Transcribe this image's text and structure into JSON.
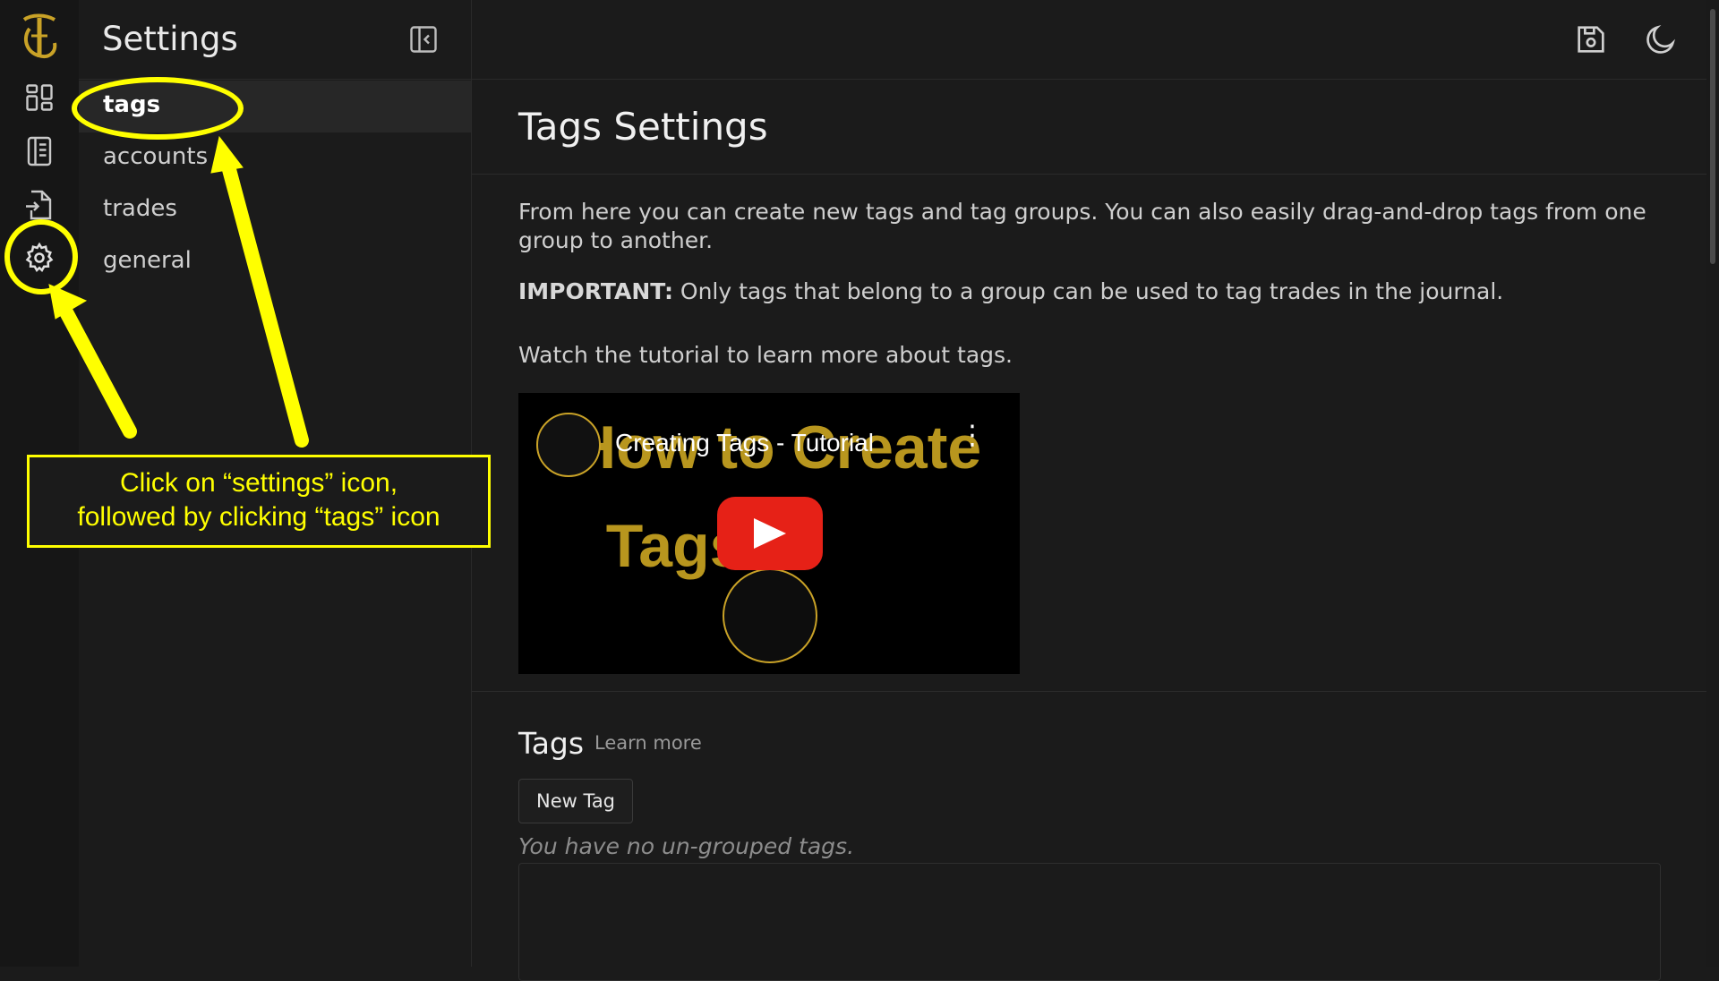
{
  "rail": {
    "items": [
      {
        "name": "logo"
      },
      {
        "name": "dashboard-icon"
      },
      {
        "name": "journal-icon"
      },
      {
        "name": "import-icon"
      },
      {
        "name": "settings-icon"
      }
    ]
  },
  "sidebar": {
    "title": "Settings",
    "items": [
      {
        "label": "tags",
        "active": true
      },
      {
        "label": "accounts"
      },
      {
        "label": "trades"
      },
      {
        "label": "general"
      }
    ]
  },
  "topbar": {
    "icons": [
      "save-icon",
      "moon-icon"
    ]
  },
  "main": {
    "title": "Tags Settings",
    "intro": "From here you can create new tags and tag groups. You can also easily drag-and-drop tags from one group to another.",
    "important_label": "IMPORTANT:",
    "important_text": " Only tags that belong to a group can be used to tag trades in the journal.",
    "tutorial_text": "Watch the tutorial to learn more about tags.",
    "video": {
      "title": "Creating Tags - Tutorial",
      "background_text": "How to Create\n  Tags"
    },
    "tags_section": {
      "title": "Tags",
      "learn_more": "Learn more",
      "new_tag_button": "New Tag",
      "empty_message": "You have no un-grouped tags."
    }
  },
  "annotation": {
    "line1": "Click on “settings” icon,",
    "line2": "followed by clicking “tags” icon",
    "color": "#ffff00"
  },
  "colors": {
    "background": "#1b1b1b",
    "accent": "#ffff00",
    "logo_gold": "#c9a227",
    "play_red": "#e62117"
  }
}
